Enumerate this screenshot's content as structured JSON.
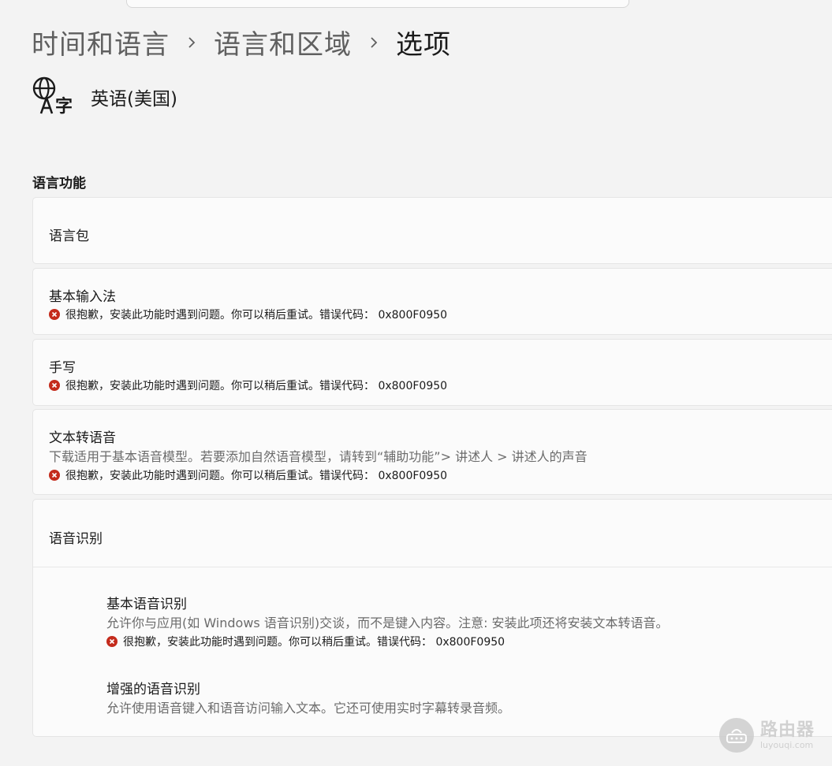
{
  "breadcrumb": {
    "items": [
      "时间和语言",
      "语言和区域",
      "选项"
    ]
  },
  "language": {
    "icon": "language-icon",
    "name": "英语(美国)"
  },
  "section": {
    "title": "语言功能"
  },
  "features": {
    "language_pack": {
      "title": "语言包"
    },
    "basic_typing": {
      "title": "基本输入法",
      "error": "很抱歉，安装此功能时遇到问题。你可以稍后重试。错误代码： 0x800F0950"
    },
    "handwriting": {
      "title": "手写",
      "error": "很抱歉，安装此功能时遇到问题。你可以稍后重试。错误代码： 0x800F0950"
    },
    "text_to_speech": {
      "title": "文本转语音",
      "description": "下载适用于基本语音模型。若要添加自然语音模型，请转到“辅助功能”> 讲述人 > 讲述人的声音",
      "error": "很抱歉，安装此功能时遇到问题。你可以稍后重试。错误代码： 0x800F0950"
    },
    "speech_recognition": {
      "title": "语音识别",
      "basic": {
        "title": "基本语音识别",
        "description": "允许你与应用(如 Windows 语音识别)交谈，而不是键入内容。注意: 安装此项还将安装文本转语音。",
        "error": "很抱歉，安装此功能时遇到问题。你可以稍后重试。错误代码： 0x800F0950"
      },
      "enhanced": {
        "title": "增强的语音识别",
        "description": "允许使用语音键入和语音访问输入文本。它还可使用实时字幕转录音频。"
      }
    }
  },
  "watermark": {
    "main": "路由器",
    "sub": "luyouqi.com"
  },
  "colors": {
    "error": "#c42b1c",
    "card_bg": "#fbfbfb",
    "page_bg": "#f3f3f3"
  }
}
